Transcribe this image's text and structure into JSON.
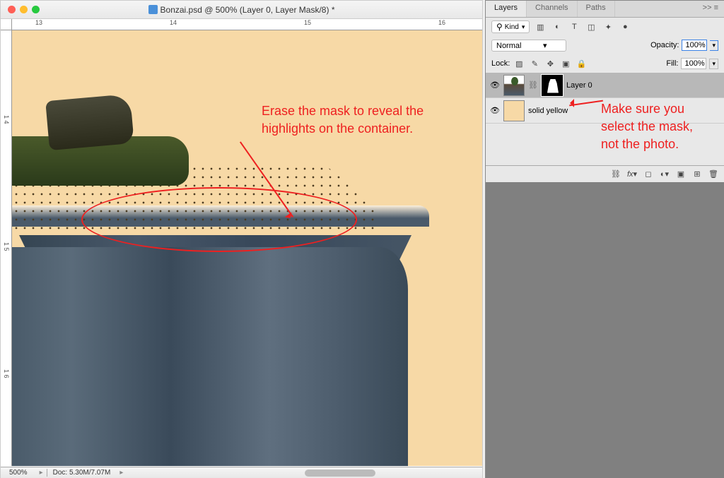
{
  "window": {
    "title": "Bonzai.psd @ 500% (Layer 0, Layer Mask/8) *"
  },
  "ruler_h": [
    "13",
    "14",
    "15",
    "16"
  ],
  "ruler_v_major": [
    "1 4",
    "1 5",
    "1 6"
  ],
  "zoom": "500%",
  "doc_size": "Doc: 5.30M/7.07M",
  "annotation_left_line1": "Erase the mask to reveal the",
  "annotation_left_line2": "highlights on the container.",
  "annotation_right_line1": "Make sure you",
  "annotation_right_line2": "select the mask,",
  "annotation_right_line3": "not the photo.",
  "panel": {
    "tabs": [
      "Layers",
      "Channels",
      "Paths"
    ],
    "collapse": ">>",
    "filter_label": "Kind",
    "blend_label": "Normal",
    "opacity_label": "Opacity:",
    "opacity_value": "100%",
    "lock_label": "Lock:",
    "fill_label": "Fill:",
    "fill_value": "100%",
    "layers": [
      {
        "name": "Layer 0"
      },
      {
        "name": "solid yellow"
      }
    ]
  }
}
